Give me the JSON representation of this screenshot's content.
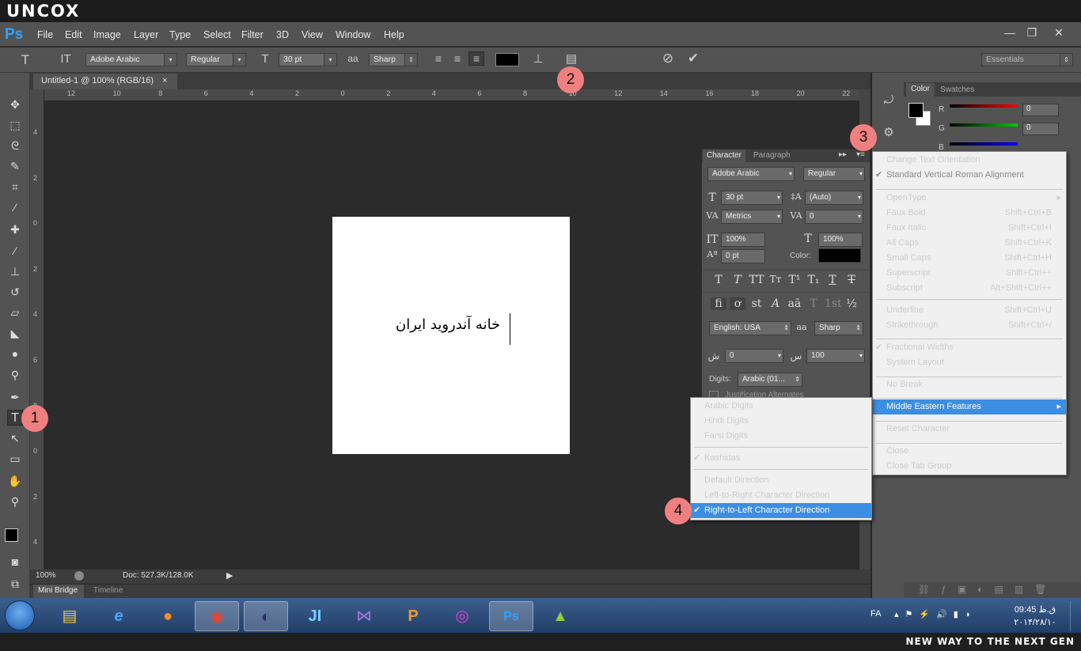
{
  "banner": {
    "brand": "UNCOX",
    "tagline": "NEW WAY TO THE NEXT GEN"
  },
  "app": {
    "logo": "Ps"
  },
  "menus": [
    "File",
    "Edit",
    "Image",
    "Layer",
    "Type",
    "Select",
    "Filter",
    "3D",
    "View",
    "Window",
    "Help"
  ],
  "window_controls": {
    "minimize": "—",
    "restore": "❐",
    "close": "✕"
  },
  "options": {
    "font_family": "Adobe Arabic",
    "font_style": "Regular",
    "font_size": "30 pt",
    "antialias": "Sharp",
    "workspace": "Essentials",
    "text_color": "#000000"
  },
  "document": {
    "tab_title": "Untitled-1 @ 100% (RGB/16)",
    "tab_close": "×",
    "text": "خانه آندروید ایران",
    "zoom": "100%",
    "doc_info": "Doc: 527.3K/128.0K"
  },
  "ruler": {
    "h": [
      "12",
      "10",
      "8",
      "6",
      "4",
      "2",
      "0",
      "2",
      "4",
      "6",
      "8",
      "10",
      "12",
      "14",
      "16",
      "18",
      "20",
      "22"
    ],
    "v": [
      "4",
      "2",
      "0",
      "2",
      "4",
      "6",
      "8",
      "0",
      "2",
      "4"
    ]
  },
  "bottom_tabs": [
    "Mini Bridge",
    "Timeline"
  ],
  "color_panel": {
    "tabs": [
      "Color",
      "Swatches"
    ],
    "channels": [
      {
        "label": "R",
        "value": "0"
      },
      {
        "label": "G",
        "value": "0"
      },
      {
        "label": "B",
        "value": "0"
      }
    ]
  },
  "character_panel": {
    "tabs": [
      "Character",
      "Paragraph"
    ],
    "font_family": "Adobe Arabic",
    "font_style": "Regular",
    "size": "30 pt",
    "leading": "(Auto)",
    "kerning": "Metrics",
    "tracking": "0",
    "vscale": "100%",
    "hscale": "100%",
    "baseline": "0 pt",
    "color_label": "Color:",
    "language": "English: USA",
    "antialias": "Sharp",
    "kashida_a": "0",
    "kashida_b": "100",
    "digits_label": "Digits:",
    "digits_value": "Arabic (01...",
    "justification_label": "Justification Alternates"
  },
  "flyout_menu": [
    {
      "label": "Change Text Orientation",
      "shortcut": "",
      "checked": false,
      "disabled": false
    },
    {
      "label": "Standard Vertical Roman Alignment",
      "shortcut": "",
      "checked": true,
      "disabled": true
    },
    {
      "label": "OpenType",
      "shortcut": "",
      "checked": false,
      "disabled": false,
      "submenu": true
    },
    {
      "label": "Faux Bold",
      "shortcut": "Shift+Ctrl+B"
    },
    {
      "label": "Faux Italic",
      "shortcut": "Shift+Ctrl+I"
    },
    {
      "label": "All Caps",
      "shortcut": "Shift+Ctrl+K"
    },
    {
      "label": "Small Caps",
      "shortcut": "Shift+Ctrl+H"
    },
    {
      "label": "Superscript",
      "shortcut": "Shift+Ctrl++"
    },
    {
      "label": "Subscript",
      "shortcut": "Alt+Shift+Ctrl++"
    },
    {
      "label": "Underline",
      "shortcut": "Shift+Ctrl+U"
    },
    {
      "label": "Strikethrough",
      "shortcut": "Shift+Ctrl+/"
    },
    {
      "label": "Fractional Widths",
      "shortcut": "",
      "checked": true
    },
    {
      "label": "System Layout",
      "shortcut": ""
    },
    {
      "label": "No Break",
      "shortcut": ""
    },
    {
      "label": "Middle Eastern Features",
      "shortcut": "",
      "highlighted": true,
      "submenu": true
    },
    {
      "label": "Reset Character",
      "shortcut": ""
    },
    {
      "label": "Close",
      "shortcut": ""
    },
    {
      "label": "Close Tab Group",
      "shortcut": ""
    }
  ],
  "submenu": [
    {
      "label": "Arabic Digits"
    },
    {
      "label": "Hindi Digits"
    },
    {
      "label": "Farsi Digits"
    },
    {
      "label": "Kashidas",
      "checked": true
    },
    {
      "label": "Default Direction"
    },
    {
      "label": "Left-to-Right Character Direction"
    },
    {
      "label": "Right-to-Left Character Direction",
      "checked": true,
      "highlighted": true
    }
  ],
  "markers": [
    "1",
    "2",
    "3",
    "4"
  ],
  "taskbar": {
    "apps": [
      "file-explorer",
      "internet-explorer",
      "firefox",
      "chrome",
      "eclipse",
      "intellij",
      "visual-studio",
      "powerpoint",
      "media-player",
      "photoshop",
      "android"
    ],
    "lang": "FA",
    "time": "09:45 ق.ظ",
    "date": "۲۰۱۴/۲۸/۱۰"
  }
}
